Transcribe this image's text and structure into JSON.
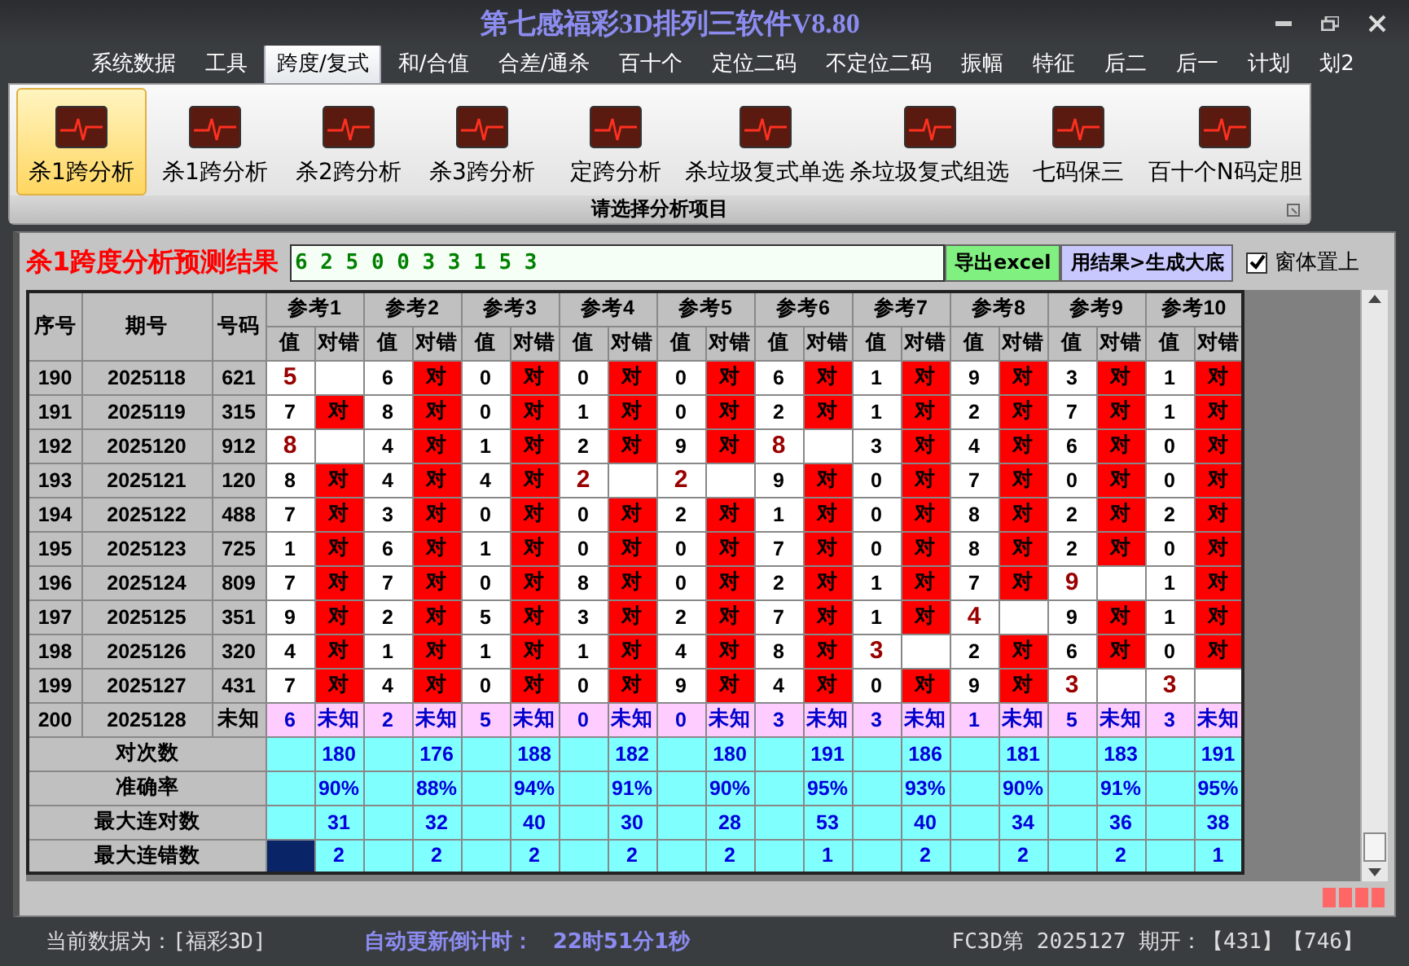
{
  "window": {
    "title": "第七感福彩3D排列三软件V8.80"
  },
  "menu": [
    {
      "label": "系统数据",
      "selected": false
    },
    {
      "label": "工具",
      "selected": false
    },
    {
      "label": "跨度/复式",
      "selected": true
    },
    {
      "label": "和/合值",
      "selected": false
    },
    {
      "label": "合差/通杀",
      "selected": false
    },
    {
      "label": "百十个",
      "selected": false
    },
    {
      "label": "定位二码",
      "selected": false
    },
    {
      "label": "不定位二码",
      "selected": false
    },
    {
      "label": "振幅",
      "selected": false
    },
    {
      "label": "特征",
      "selected": false
    },
    {
      "label": "后二",
      "selected": false
    },
    {
      "label": "后一",
      "selected": false
    },
    {
      "label": "计划",
      "selected": false
    },
    {
      "label": "划2",
      "selected": false
    }
  ],
  "ribbon": {
    "caption": "请选择分析项目",
    "items": [
      {
        "label": "杀1跨分析",
        "selected": true
      },
      {
        "label": "杀1跨分析",
        "selected": false
      },
      {
        "label": "杀2跨分析",
        "selected": false
      },
      {
        "label": "杀3跨分析",
        "selected": false
      },
      {
        "label": "定跨分析",
        "selected": false
      },
      {
        "label": "杀垃圾复式单选",
        "selected": false
      },
      {
        "label": "杀垃圾复式组选",
        "selected": false
      },
      {
        "label": "七码保三",
        "selected": false
      },
      {
        "label": "百十个N码定胆",
        "selected": false
      }
    ]
  },
  "result": {
    "label": "杀1跨度分析预测结果",
    "value": "6 2 5 0 0 3 3 1 5 3",
    "export_button": "导出excel",
    "generate_button": "用结果>生成大底",
    "pin_on_top": {
      "label": "窗体置上",
      "checked": true
    }
  },
  "table": {
    "columns": [
      "序号",
      "期号",
      "号码"
    ],
    "refs": [
      {
        "label": "参考1",
        "sub": [
          "值",
          "对错"
        ]
      },
      {
        "label": "参考2",
        "sub": [
          "值",
          "对错"
        ]
      },
      {
        "label": "参考3",
        "sub": [
          "值",
          "对错"
        ]
      },
      {
        "label": "参考4",
        "sub": [
          "值",
          "对错"
        ]
      },
      {
        "label": "参考5",
        "sub": [
          "值",
          "对错"
        ]
      },
      {
        "label": "参考6",
        "sub": [
          "值",
          "对错"
        ]
      },
      {
        "label": "参考7",
        "sub": [
          "值",
          "对错"
        ]
      },
      {
        "label": "参考8",
        "sub": [
          "值",
          "对错"
        ]
      },
      {
        "label": "参考9",
        "sub": [
          "值",
          "对错"
        ]
      },
      {
        "label": "参考10",
        "sub": [
          "值",
          "对错"
        ]
      }
    ],
    "rows": [
      {
        "kind": "history",
        "seq": "190",
        "period": "2025118",
        "number": "621",
        "refs": [
          {
            "value": "5",
            "correct": false
          },
          {
            "value": "6",
            "correct": true,
            "result": "对"
          },
          {
            "value": "0",
            "correct": true,
            "result": "对"
          },
          {
            "value": "0",
            "correct": true,
            "result": "对"
          },
          {
            "value": "0",
            "correct": true,
            "result": "对"
          },
          {
            "value": "6",
            "correct": true,
            "result": "对"
          },
          {
            "value": "1",
            "correct": true,
            "result": "对"
          },
          {
            "value": "9",
            "correct": true,
            "result": "对"
          },
          {
            "value": "3",
            "correct": true,
            "result": "对"
          },
          {
            "value": "1",
            "correct": true,
            "result": "对"
          }
        ]
      },
      {
        "kind": "history",
        "seq": "191",
        "period": "2025119",
        "number": "315",
        "refs": [
          {
            "value": "7",
            "correct": true,
            "result": "对"
          },
          {
            "value": "8",
            "correct": true,
            "result": "对"
          },
          {
            "value": "0",
            "correct": true,
            "result": "对"
          },
          {
            "value": "1",
            "correct": true,
            "result": "对"
          },
          {
            "value": "0",
            "correct": true,
            "result": "对"
          },
          {
            "value": "2",
            "correct": true,
            "result": "对"
          },
          {
            "value": "1",
            "correct": true,
            "result": "对"
          },
          {
            "value": "2",
            "correct": true,
            "result": "对"
          },
          {
            "value": "7",
            "correct": true,
            "result": "对"
          },
          {
            "value": "1",
            "correct": true,
            "result": "对"
          }
        ]
      },
      {
        "kind": "history",
        "seq": "192",
        "period": "2025120",
        "number": "912",
        "refs": [
          {
            "value": "8",
            "correct": false
          },
          {
            "value": "4",
            "correct": true,
            "result": "对"
          },
          {
            "value": "1",
            "correct": true,
            "result": "对"
          },
          {
            "value": "2",
            "correct": true,
            "result": "对"
          },
          {
            "value": "9",
            "correct": true,
            "result": "对"
          },
          {
            "value": "8",
            "correct": false
          },
          {
            "value": "3",
            "correct": true,
            "result": "对"
          },
          {
            "value": "4",
            "correct": true,
            "result": "对"
          },
          {
            "value": "6",
            "correct": true,
            "result": "对"
          },
          {
            "value": "0",
            "correct": true,
            "result": "对"
          }
        ]
      },
      {
        "kind": "history",
        "seq": "193",
        "period": "2025121",
        "number": "120",
        "refs": [
          {
            "value": "8",
            "correct": true,
            "result": "对"
          },
          {
            "value": "4",
            "correct": true,
            "result": "对"
          },
          {
            "value": "4",
            "correct": true,
            "result": "对"
          },
          {
            "value": "2",
            "correct": false
          },
          {
            "value": "2",
            "correct": false
          },
          {
            "value": "9",
            "correct": true,
            "result": "对"
          },
          {
            "value": "0",
            "correct": true,
            "result": "对"
          },
          {
            "value": "7",
            "correct": true,
            "result": "对"
          },
          {
            "value": "0",
            "correct": true,
            "result": "对"
          },
          {
            "value": "0",
            "correct": true,
            "result": "对"
          }
        ]
      },
      {
        "kind": "history",
        "seq": "194",
        "period": "2025122",
        "number": "488",
        "refs": [
          {
            "value": "7",
            "correct": true,
            "result": "对"
          },
          {
            "value": "3",
            "correct": true,
            "result": "对"
          },
          {
            "value": "0",
            "correct": true,
            "result": "对"
          },
          {
            "value": "0",
            "correct": true,
            "result": "对"
          },
          {
            "value": "2",
            "correct": true,
            "result": "对"
          },
          {
            "value": "1",
            "correct": true,
            "result": "对"
          },
          {
            "value": "0",
            "correct": true,
            "result": "对"
          },
          {
            "value": "8",
            "correct": true,
            "result": "对"
          },
          {
            "value": "2",
            "correct": true,
            "result": "对"
          },
          {
            "value": "2",
            "correct": true,
            "result": "对"
          }
        ]
      },
      {
        "kind": "history",
        "seq": "195",
        "period": "2025123",
        "number": "725",
        "refs": [
          {
            "value": "1",
            "correct": true,
            "result": "对"
          },
          {
            "value": "6",
            "correct": true,
            "result": "对"
          },
          {
            "value": "1",
            "correct": true,
            "result": "对"
          },
          {
            "value": "0",
            "correct": true,
            "result": "对"
          },
          {
            "value": "0",
            "correct": true,
            "result": "对"
          },
          {
            "value": "7",
            "correct": true,
            "result": "对"
          },
          {
            "value": "0",
            "correct": true,
            "result": "对"
          },
          {
            "value": "8",
            "correct": true,
            "result": "对"
          },
          {
            "value": "2",
            "correct": true,
            "result": "对"
          },
          {
            "value": "0",
            "correct": true,
            "result": "对"
          }
        ]
      },
      {
        "kind": "history",
        "seq": "196",
        "period": "2025124",
        "number": "809",
        "refs": [
          {
            "value": "7",
            "correct": true,
            "result": "对"
          },
          {
            "value": "7",
            "correct": true,
            "result": "对"
          },
          {
            "value": "0",
            "correct": true,
            "result": "对"
          },
          {
            "value": "8",
            "correct": true,
            "result": "对"
          },
          {
            "value": "0",
            "correct": true,
            "result": "对"
          },
          {
            "value": "2",
            "correct": true,
            "result": "对"
          },
          {
            "value": "1",
            "correct": true,
            "result": "对"
          },
          {
            "value": "7",
            "correct": true,
            "result": "对"
          },
          {
            "value": "9",
            "correct": false
          },
          {
            "value": "1",
            "correct": true,
            "result": "对"
          }
        ]
      },
      {
        "kind": "history",
        "seq": "197",
        "period": "2025125",
        "number": "351",
        "refs": [
          {
            "value": "9",
            "correct": true,
            "result": "对"
          },
          {
            "value": "2",
            "correct": true,
            "result": "对"
          },
          {
            "value": "5",
            "correct": true,
            "result": "对"
          },
          {
            "value": "3",
            "correct": true,
            "result": "对"
          },
          {
            "value": "2",
            "correct": true,
            "result": "对"
          },
          {
            "value": "7",
            "correct": true,
            "result": "对"
          },
          {
            "value": "1",
            "correct": true,
            "result": "对"
          },
          {
            "value": "4",
            "correct": false
          },
          {
            "value": "9",
            "correct": true,
            "result": "对"
          },
          {
            "value": "1",
            "correct": true,
            "result": "对"
          }
        ]
      },
      {
        "kind": "history",
        "seq": "198",
        "period": "2025126",
        "number": "320",
        "refs": [
          {
            "value": "4",
            "correct": true,
            "result": "对"
          },
          {
            "value": "1",
            "correct": true,
            "result": "对"
          },
          {
            "value": "1",
            "correct": true,
            "result": "对"
          },
          {
            "value": "1",
            "correct": true,
            "result": "对"
          },
          {
            "value": "4",
            "correct": true,
            "result": "对"
          },
          {
            "value": "8",
            "correct": true,
            "result": "对"
          },
          {
            "value": "3",
            "correct": false
          },
          {
            "value": "2",
            "correct": true,
            "result": "对"
          },
          {
            "value": "6",
            "correct": true,
            "result": "对"
          },
          {
            "value": "0",
            "correct": true,
            "result": "对"
          }
        ]
      },
      {
        "kind": "history",
        "seq": "199",
        "period": "2025127",
        "number": "431",
        "refs": [
          {
            "value": "7",
            "correct": true,
            "result": "对"
          },
          {
            "value": "4",
            "correct": true,
            "result": "对"
          },
          {
            "value": "0",
            "correct": true,
            "result": "对"
          },
          {
            "value": "0",
            "correct": true,
            "result": "对"
          },
          {
            "value": "9",
            "correct": true,
            "result": "对"
          },
          {
            "value": "4",
            "correct": true,
            "result": "对"
          },
          {
            "value": "0",
            "correct": true,
            "result": "对"
          },
          {
            "value": "9",
            "correct": true,
            "result": "对"
          },
          {
            "value": "3",
            "correct": false
          },
          {
            "value": "3",
            "correct": false
          }
        ]
      },
      {
        "kind": "pending",
        "seq": "200",
        "period": "2025128",
        "number": "未知",
        "refs": [
          {
            "value": "6",
            "result": "未知"
          },
          {
            "value": "2",
            "result": "未知"
          },
          {
            "value": "5",
            "result": "未知"
          },
          {
            "value": "0",
            "result": "未知"
          },
          {
            "value": "0",
            "result": "未知"
          },
          {
            "value": "3",
            "result": "未知"
          },
          {
            "value": "3",
            "result": "未知"
          },
          {
            "value": "1",
            "result": "未知"
          },
          {
            "value": "5",
            "result": "未知"
          },
          {
            "value": "3",
            "result": "未知"
          }
        ]
      }
    ],
    "summary": [
      {
        "label": "对次数",
        "values": [
          "180",
          "176",
          "188",
          "182",
          "180",
          "191",
          "186",
          "181",
          "183",
          "191"
        ],
        "cursor": false
      },
      {
        "label": "准确率",
        "values": [
          "90%",
          "88%",
          "94%",
          "91%",
          "90%",
          "95%",
          "93%",
          "90%",
          "91%",
          "95%"
        ],
        "cursor": false
      },
      {
        "label": "最大连对数",
        "values": [
          "31",
          "32",
          "40",
          "30",
          "28",
          "53",
          "40",
          "34",
          "36",
          "38"
        ],
        "cursor": false
      },
      {
        "label": "最大连错数",
        "values": [
          "2",
          "2",
          "2",
          "2",
          "2",
          "1",
          "2",
          "2",
          "2",
          "1"
        ],
        "cursor": true
      }
    ]
  },
  "status_bar": {
    "data_source": "当前数据为：[福彩3D]",
    "countdown_label": "自动更新倒计时：",
    "countdown": "22时51分1秒",
    "latest": "FC3D第 2025127 期开：【431】【746】"
  }
}
